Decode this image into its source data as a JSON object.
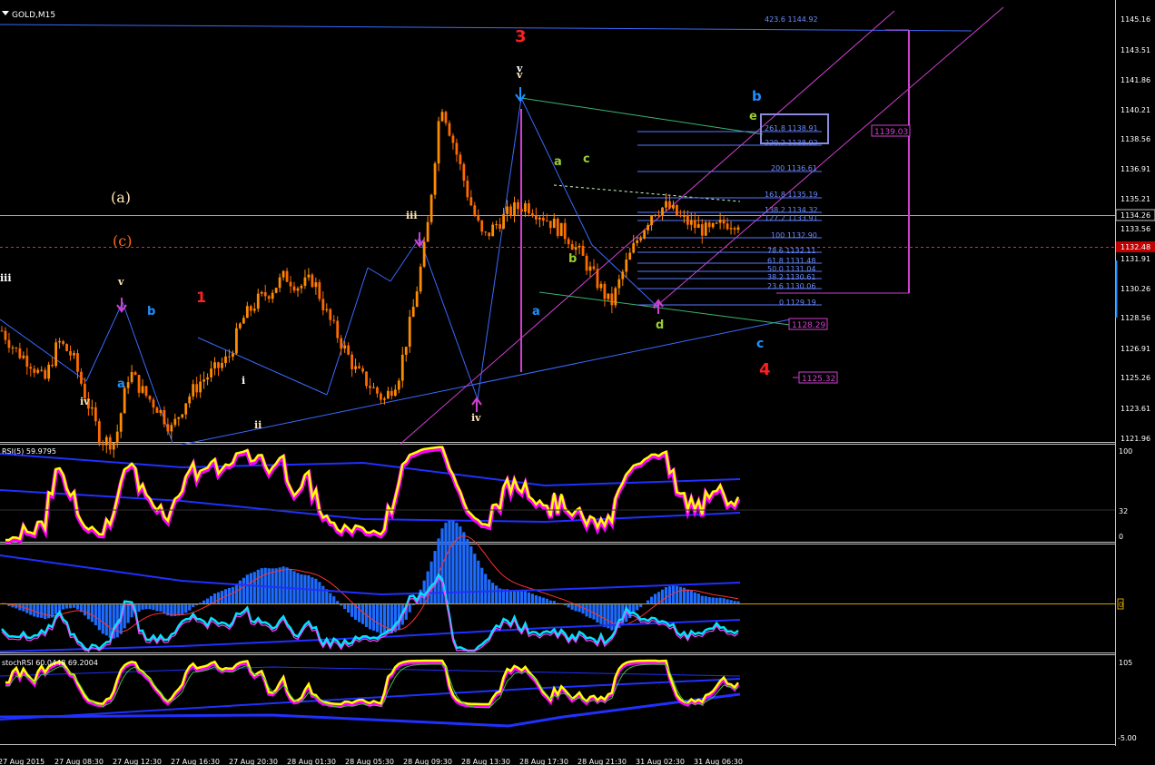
{
  "window": {
    "symbol_label": "GOLD,M15"
  },
  "price_axis": {
    "ticks": [
      "1145.16",
      "1143.51",
      "1141.86",
      "1140.21",
      "1138.56",
      "1136.91",
      "1135.21",
      "1133.56",
      "1131.91",
      "1130.26",
      "1128.56",
      "1126.91",
      "1125.26",
      "1123.61",
      "1121.96"
    ],
    "current_price_label": "1134.26",
    "bid_line_label": "1132.48"
  },
  "fib_levels": [
    {
      "label": "423.6  1144.92"
    },
    {
      "label": "261.8  1138.91"
    },
    {
      "label": "229.2  1138.02"
    },
    {
      "label": "200  1136.61"
    },
    {
      "label": "161.8  1135.19"
    },
    {
      "label": "138.2  1134.32"
    },
    {
      "label": "127.2  1133.91"
    },
    {
      "label": "100  1132.90"
    },
    {
      "label": "78.6  1132.11"
    },
    {
      "label": "61.8  1131.48"
    },
    {
      "label": "50.0  1131.04"
    },
    {
      "label": "38.2  1130.61"
    },
    {
      "label": "23.6  1130.06"
    },
    {
      "label": "0  1129.19"
    }
  ],
  "price_boxes": {
    "target_upper": "1139.03",
    "target_mid": "1128.29",
    "target_low": "1125.32"
  },
  "wave_labels": {
    "w_iii_left": "iii",
    "w_a_paren": "(a)",
    "w_c_paren": "(c)",
    "w_iv_left": "iv",
    "w_a_left": "a",
    "w_v_left": "v",
    "w_b_left": "b",
    "w_1": "1",
    "w_i": "i",
    "w_ii": "ii",
    "w_iii_mid": "iii",
    "w_iv_mid": "iv",
    "w_3": "3",
    "w_v_top1": "v",
    "w_v_top2": "v",
    "w_a_right": "a",
    "w_a_green": "a",
    "w_b_green": "b",
    "w_c_green": "c",
    "w_d_green": "d",
    "w_b_blue": "b",
    "w_e_green": "e",
    "w_c_blue": "c",
    "w_4": "4"
  },
  "rsi_panel": {
    "title": "RSI(5) 59.9795",
    "scale": [
      "100",
      "32",
      "0"
    ]
  },
  "macd_panel": {
    "zero_marker": "0"
  },
  "stoch_panel": {
    "title": "stochRSI 60.0448 69.2004",
    "scale": [
      "105",
      "-5.00"
    ]
  },
  "time_axis": {
    "labels": [
      "27 Aug 2015",
      "27 Aug 08:30",
      "27 Aug 12:30",
      "27 Aug 16:30",
      "27 Aug 20:30",
      "28 Aug 01:30",
      "28 Aug 05:30",
      "28 Aug 09:30",
      "28 Aug 13:30",
      "28 Aug 17:30",
      "28 Aug 21:30",
      "31 Aug 02:30",
      "31 Aug 06:30"
    ]
  },
  "colors": {
    "background": "#000000",
    "grid_axis": "#c0c0c0",
    "bull_candle": "#ff8c00",
    "bear_candle": "#ff6a00",
    "trend_blue": "#3a6bff",
    "fib_blue": "#5a78ff",
    "channel_magenta": "#d040d0",
    "green_line": "#3cb371",
    "red_dotted": "#ff2020",
    "rsi_yellow": "#ffff00",
    "rsi_magenta": "#ff00ff",
    "macd_hist": "#1e6cff",
    "cyan": "#00e5ff",
    "wave_red": "#ff2020",
    "wave_white": "#ffffff",
    "wave_green": "#9acd32",
    "wave_blue": "#1e90ff",
    "wave_orange": "#ff6a1a",
    "wave_cream": "#ffe4b5"
  },
  "chart_data": {
    "type": "candlestick",
    "title": "GOLD,M15",
    "ylim": [
      1121.96,
      1146.0
    ],
    "x": [
      "27 Aug 2015",
      "27 Aug 08:30",
      "27 Aug 12:30",
      "27 Aug 16:30",
      "27 Aug 20:30",
      "28 Aug 01:30",
      "28 Aug 05:30",
      "28 Aug 09:30",
      "28 Aug 13:30",
      "28 Aug 17:30",
      "28 Aug 21:30",
      "31 Aug 02:30",
      "31 Aug 06:30"
    ],
    "close_path": [
      1128.0,
      1126.9,
      1126.3,
      1125.2,
      1127.4,
      1126.6,
      1124.2,
      1122.0,
      1121.9,
      1125.8,
      1124.6,
      1123.8,
      1122.6,
      1124.2,
      1125.2,
      1125.8,
      1126.5,
      1128.6,
      1129.6,
      1130.2,
      1131.0,
      1130.4,
      1130.8,
      1128.8,
      1127.3,
      1125.8,
      1125.0,
      1124.2,
      1125.5,
      1129.0,
      1133.2,
      1140.6,
      1138.0,
      1135.2,
      1133.0,
      1133.9,
      1134.6,
      1134.9,
      1134.4,
      1133.8,
      1133.1,
      1132.0,
      1130.7,
      1129.4,
      1131.5,
      1133.2,
      1134.6,
      1134.8,
      1134.1,
      1133.7,
      1133.4,
      1133.9,
      1134.0
    ],
    "horizontal_levels": {
      "current": 1134.26,
      "bid": 1132.48
    },
    "indicators": {
      "rsi": {
        "period": 5,
        "value": 59.9795,
        "ylim": [
          0,
          100
        ],
        "level": 32
      },
      "stoch_rsi": {
        "k": 60.0448,
        "d": 69.2004,
        "ylim": [
          -5,
          105
        ]
      }
    }
  }
}
